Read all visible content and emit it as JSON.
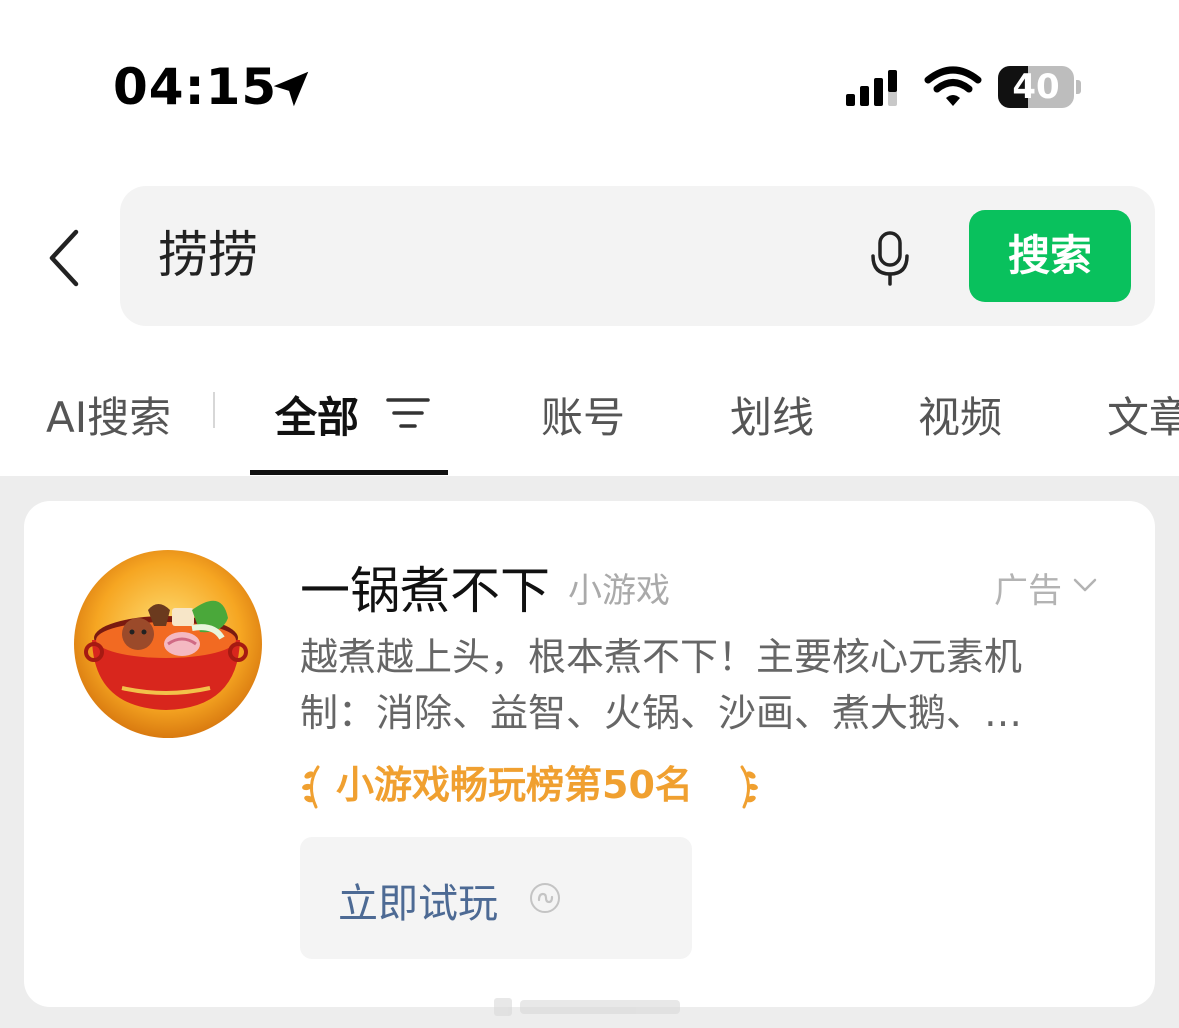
{
  "status_bar": {
    "time": "04:15",
    "battery_level": "40",
    "battery_fraction": 0.4
  },
  "search": {
    "query": "捞捞",
    "button_label": "搜索"
  },
  "tabs": [
    {
      "label": "AI搜索"
    },
    {
      "label": "全部"
    },
    {
      "label": "账号"
    },
    {
      "label": "划线"
    },
    {
      "label": "视频"
    },
    {
      "label": "文章"
    }
  ],
  "active_tab_index": 1,
  "result": {
    "title": "一锅煮不下",
    "category": "小游戏",
    "ad_label": "广告",
    "description_line1": "越煮越上头，根本煮不下！主要核心元素机",
    "description_line2": "制：消除、益智、火锅、沙画、煮大鹅、…",
    "rank_text": "小游戏畅玩榜第50名",
    "play_button_label": "立即试玩"
  },
  "colors": {
    "accent_green": "#09c15d",
    "rank_orange": "#f0a030",
    "play_text_blue": "#4d6a94",
    "page_gray": "#ededed"
  },
  "icons": [
    "location-arrow-icon",
    "signal-icon",
    "wifi-icon",
    "battery-icon",
    "back-chevron-icon",
    "microphone-icon",
    "filter-icon",
    "game-logo-icon",
    "chevron-down-icon",
    "laurel-icon",
    "mini-program-icon"
  ]
}
